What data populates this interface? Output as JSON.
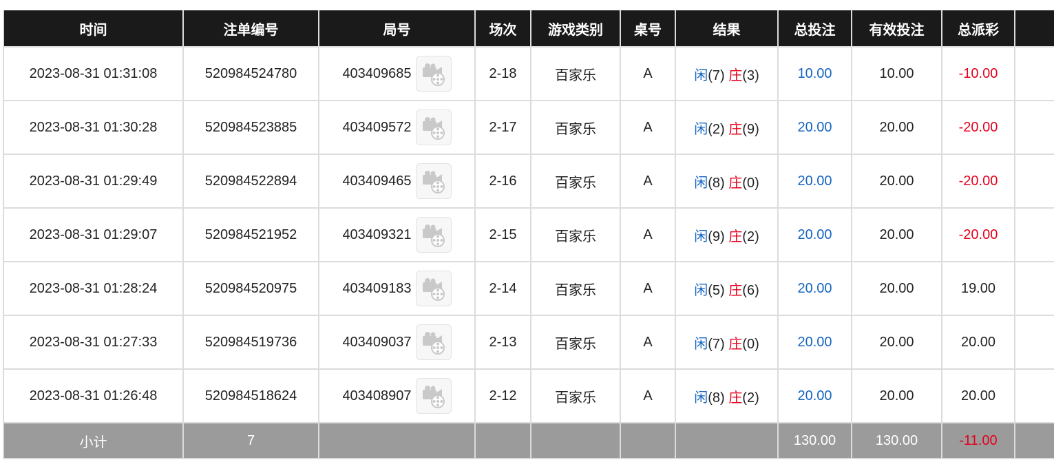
{
  "columns": [
    "时间",
    "注单编号",
    "局号",
    "场次",
    "游戏类别",
    "桌号",
    "结果",
    "总投注",
    "有效投注",
    "总派彩",
    ""
  ],
  "rows": [
    {
      "time": "2023-08-31 01:31:08",
      "bet_id": "520984524780",
      "round": "403409685",
      "session": "2-18",
      "game": "百家乐",
      "table": "A",
      "player_label": "闲",
      "player_val": "(7)",
      "banker_label": "庄",
      "banker_val": "(3)",
      "total_bet": "10.00",
      "valid_bet": "10.00",
      "payout": "-10.00"
    },
    {
      "time": "2023-08-31 01:30:28",
      "bet_id": "520984523885",
      "round": "403409572",
      "session": "2-17",
      "game": "百家乐",
      "table": "A",
      "player_label": "闲",
      "player_val": "(2)",
      "banker_label": "庄",
      "banker_val": "(9)",
      "total_bet": "20.00",
      "valid_bet": "20.00",
      "payout": "-20.00"
    },
    {
      "time": "2023-08-31 01:29:49",
      "bet_id": "520984522894",
      "round": "403409465",
      "session": "2-16",
      "game": "百家乐",
      "table": "A",
      "player_label": "闲",
      "player_val": "(8)",
      "banker_label": "庄",
      "banker_val": "(0)",
      "total_bet": "20.00",
      "valid_bet": "20.00",
      "payout": "-20.00"
    },
    {
      "time": "2023-08-31 01:29:07",
      "bet_id": "520984521952",
      "round": "403409321",
      "session": "2-15",
      "game": "百家乐",
      "table": "A",
      "player_label": "闲",
      "player_val": "(9)",
      "banker_label": "庄",
      "banker_val": "(2)",
      "total_bet": "20.00",
      "valid_bet": "20.00",
      "payout": "-20.00"
    },
    {
      "time": "2023-08-31 01:28:24",
      "bet_id": "520984520975",
      "round": "403409183",
      "session": "2-14",
      "game": "百家乐",
      "table": "A",
      "player_label": "闲",
      "player_val": "(5)",
      "banker_label": "庄",
      "banker_val": "(6)",
      "total_bet": "20.00",
      "valid_bet": "20.00",
      "payout": "19.00"
    },
    {
      "time": "2023-08-31 01:27:33",
      "bet_id": "520984519736",
      "round": "403409037",
      "session": "2-13",
      "game": "百家乐",
      "table": "A",
      "player_label": "闲",
      "player_val": "(7)",
      "banker_label": "庄",
      "banker_val": "(0)",
      "total_bet": "20.00",
      "valid_bet": "20.00",
      "payout": "20.00"
    },
    {
      "time": "2023-08-31 01:26:48",
      "bet_id": "520984518624",
      "round": "403408907",
      "session": "2-12",
      "game": "百家乐",
      "table": "A",
      "player_label": "闲",
      "player_val": "(8)",
      "banker_label": "庄",
      "banker_val": "(2)",
      "total_bet": "20.00",
      "valid_bet": "20.00",
      "payout": "20.00"
    }
  ],
  "subtotal": {
    "label": "小计",
    "count": "7",
    "total_bet": "130.00",
    "valid_bet": "130.00",
    "payout": "-11.00"
  },
  "colors": {
    "header_bg": "#1a1a1a",
    "footer_bg": "#9b9b9b",
    "blue": "#1565c0",
    "red": "#e5001c"
  },
  "icons": {
    "replay": "video-replay-icon"
  }
}
